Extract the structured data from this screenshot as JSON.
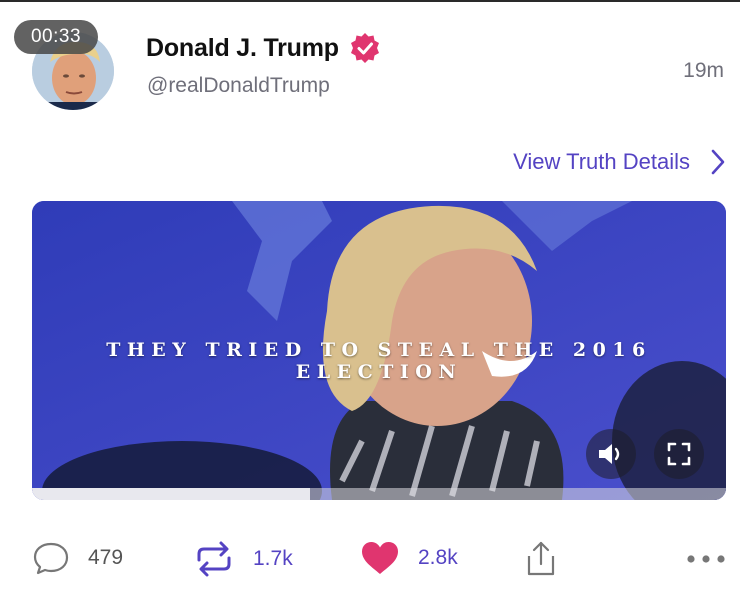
{
  "video": {
    "timer": "00:33",
    "caption": "THEY TRIED TO STEAL THE 2016 ELECTION",
    "progress_percent": 40
  },
  "post": {
    "author_name": "Donald J. Trump",
    "handle": "@realDonaldTrump",
    "time_ago": "19m",
    "details_link": "View Truth Details"
  },
  "stats": {
    "replies": "479",
    "reposts": "1.7k",
    "likes": "2.8k"
  },
  "colors": {
    "accent": "#5443c3",
    "like": "#e0356f",
    "verified": "#e0356f"
  },
  "icons": [
    "verified-badge-icon",
    "chevron-right-icon",
    "volume-icon",
    "fullscreen-icon",
    "reply-icon",
    "repost-icon",
    "heart-icon",
    "share-icon",
    "more-icon"
  ]
}
